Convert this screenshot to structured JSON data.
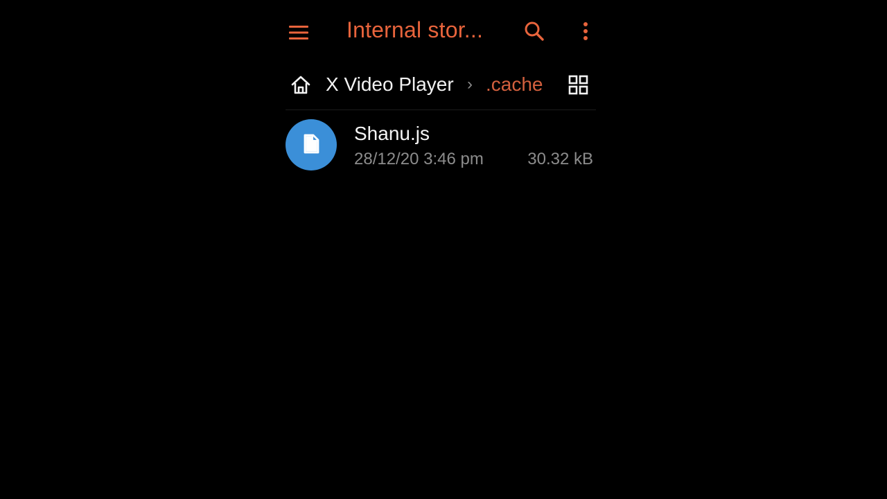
{
  "colors": {
    "accent": "#e8643c",
    "breadcrumb_current": "#d3603e",
    "file_icon_bg": "#3b8fd8",
    "background": "#000000",
    "primary_text": "#f4f4f4",
    "secondary_text": "#8c8c8c"
  },
  "toolbar": {
    "menu_icon": "hamburger-menu-icon",
    "title": "Internal stor...",
    "search_icon": "search-icon",
    "more_icon": "more-vertical-icon"
  },
  "breadcrumb": {
    "home_icon": "home-icon",
    "items": [
      {
        "label": "X Video Player"
      },
      {
        "label": ".cache"
      }
    ],
    "separator": "›",
    "view_toggle_icon": "grid-view-icon"
  },
  "files": [
    {
      "icon": "file-icon",
      "name": "Shanu.js",
      "date": "28/12/20 3:46 pm",
      "size": "30.32 kB"
    }
  ]
}
